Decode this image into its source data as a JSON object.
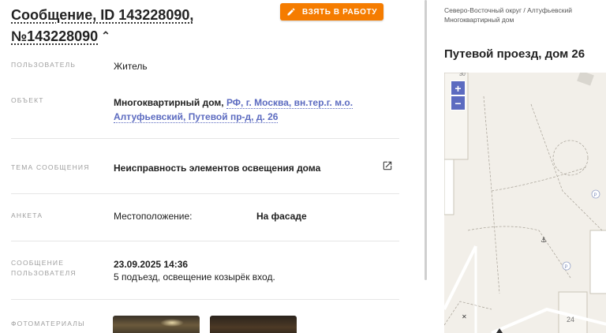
{
  "header": {
    "title_line1": "Сообщение, ID 143228090,",
    "title_line2": "№143228090",
    "collapse_icon": "chevron-up-icon",
    "take_button_label": "ВЗЯТЬ В РАБОТУ",
    "take_button_icon": "pencil-icon",
    "accent_color": "#f57c00"
  },
  "fields": {
    "user": {
      "label": "ПОЛЬЗОВАТЕЛЬ",
      "value": "Житель"
    },
    "object": {
      "label": "ОБЪЕКТ",
      "prefix": "Многоквартирный дом,",
      "link": "РФ, г. Москва, вн.тер.г. м.о. Алтуфьевский, Путевой пр-д, д. 26"
    },
    "topic": {
      "label": "ТЕМА СООБЩЕНИЯ",
      "value": "Неисправность элементов освещения дома",
      "icon": "open-in-new-icon"
    },
    "survey": {
      "label": "АНКЕТА",
      "key": "Местоположение:",
      "value": "На фасаде"
    },
    "message": {
      "label_line1": "СООБЩЕНИЕ",
      "label_line2": "ПОЛЬЗОВАТЕЛЯ",
      "date": "23.09.2025 14:36",
      "text": "5 подъезд, освещение козырёк вход."
    },
    "photos": {
      "label": "ФОТОМАТЕРИАЛЫ"
    }
  },
  "right_panel": {
    "breadcrumb_line1": "Северо-Восточный округ / Алтуфьевский",
    "breadcrumb_line2": "Многоквартирный дом",
    "address_title": "Путевой проезд, дом 26",
    "map": {
      "zoom_in": "+",
      "zoom_out": "−",
      "building_number": "24",
      "top_label": "30",
      "parking_symbol": "P"
    },
    "link_color": "#5c6bc0"
  }
}
